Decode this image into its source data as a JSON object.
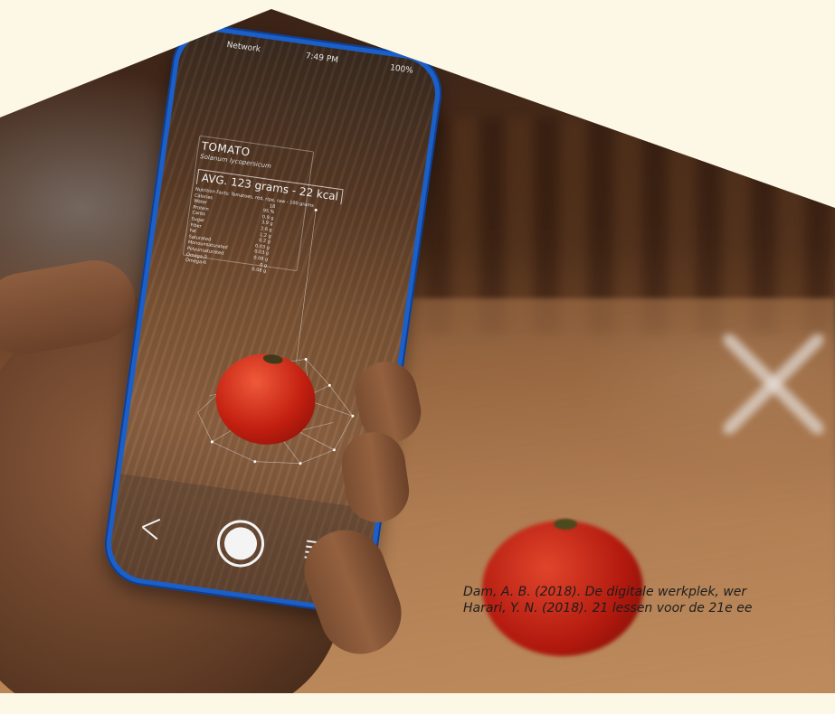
{
  "phone": {
    "status": {
      "network": "Network",
      "time": "7:49 PM",
      "battery": "100%"
    },
    "product": {
      "name": "TOMATO",
      "latin": "Solanum lycopersicum",
      "avg": "AVG. 123 grams - 22 kcal",
      "facts_heading": "Nutrition Facts: Tomatoes, red, ripe, raw - 100 grams",
      "nutrients": [
        {
          "label": "Calories",
          "value": "18"
        },
        {
          "label": "Water",
          "value": "95 %"
        },
        {
          "label": "Protein",
          "value": "0.9 g"
        },
        {
          "label": "Carbs",
          "value": "3.9 g"
        },
        {
          "label": "Sugar",
          "value": "2.6 g"
        },
        {
          "label": "Fiber",
          "value": "1.2 g"
        },
        {
          "label": "Fat",
          "value": "0.2 g"
        },
        {
          "label": "Saturated",
          "value": "0.03 g"
        },
        {
          "label": "Monounsaturated",
          "value": "0.03 g"
        },
        {
          "label": "Polyunsaturated",
          "value": "0.08 g"
        },
        {
          "label": "Omega-3",
          "value": "0 g"
        },
        {
          "label": "Omega-6",
          "value": "0.08 g"
        }
      ]
    },
    "icons": {
      "share": "share-icon",
      "capture": "shutter-button",
      "menu": "menu-icon"
    }
  },
  "citations": [
    "Dam, A. B. (2018). De digitale werkplek, wer",
    "Harari, Y. N. (2018). 21 lessen voor de 21e ee"
  ],
  "colors": {
    "background": "#fdf8e6",
    "phone_frame": "#1b5fc8",
    "tomato": "#c21f10"
  }
}
